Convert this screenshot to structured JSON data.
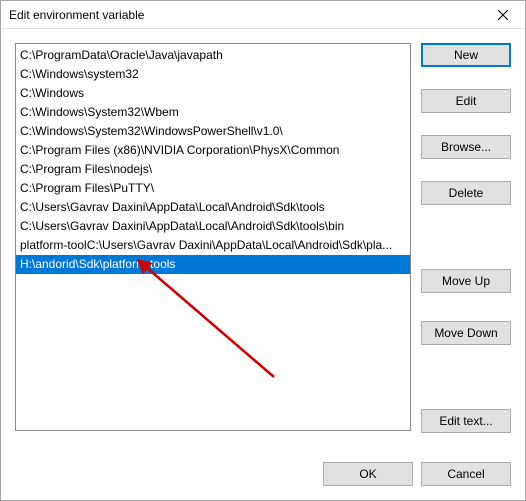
{
  "dialog": {
    "title": "Edit environment variable"
  },
  "list": {
    "items": [
      "C:\\ProgramData\\Oracle\\Java\\javapath",
      "C:\\Windows\\system32",
      "C:\\Windows",
      "C:\\Windows\\System32\\Wbem",
      "C:\\Windows\\System32\\WindowsPowerShell\\v1.0\\",
      "C:\\Program Files (x86)\\NVIDIA Corporation\\PhysX\\Common",
      "C:\\Program Files\\nodejs\\",
      "C:\\Program Files\\PuTTY\\",
      "C:\\Users\\Gavrav Daxini\\AppData\\Local\\Android\\Sdk\\tools",
      "C:\\Users\\Gavrav Daxini\\AppData\\Local\\Android\\Sdk\\tools\\bin",
      "platform-toolC:\\Users\\Gavrav Daxini\\AppData\\Local\\Android\\Sdk\\pla...",
      "H:\\andorid\\Sdk\\platform-tools"
    ],
    "selected_index": 11
  },
  "buttons": {
    "new": "New",
    "edit": "Edit",
    "browse": "Browse...",
    "delete": "Delete",
    "move_up": "Move Up",
    "move_down": "Move Down",
    "edit_text": "Edit text...",
    "ok": "OK",
    "cancel": "Cancel"
  }
}
